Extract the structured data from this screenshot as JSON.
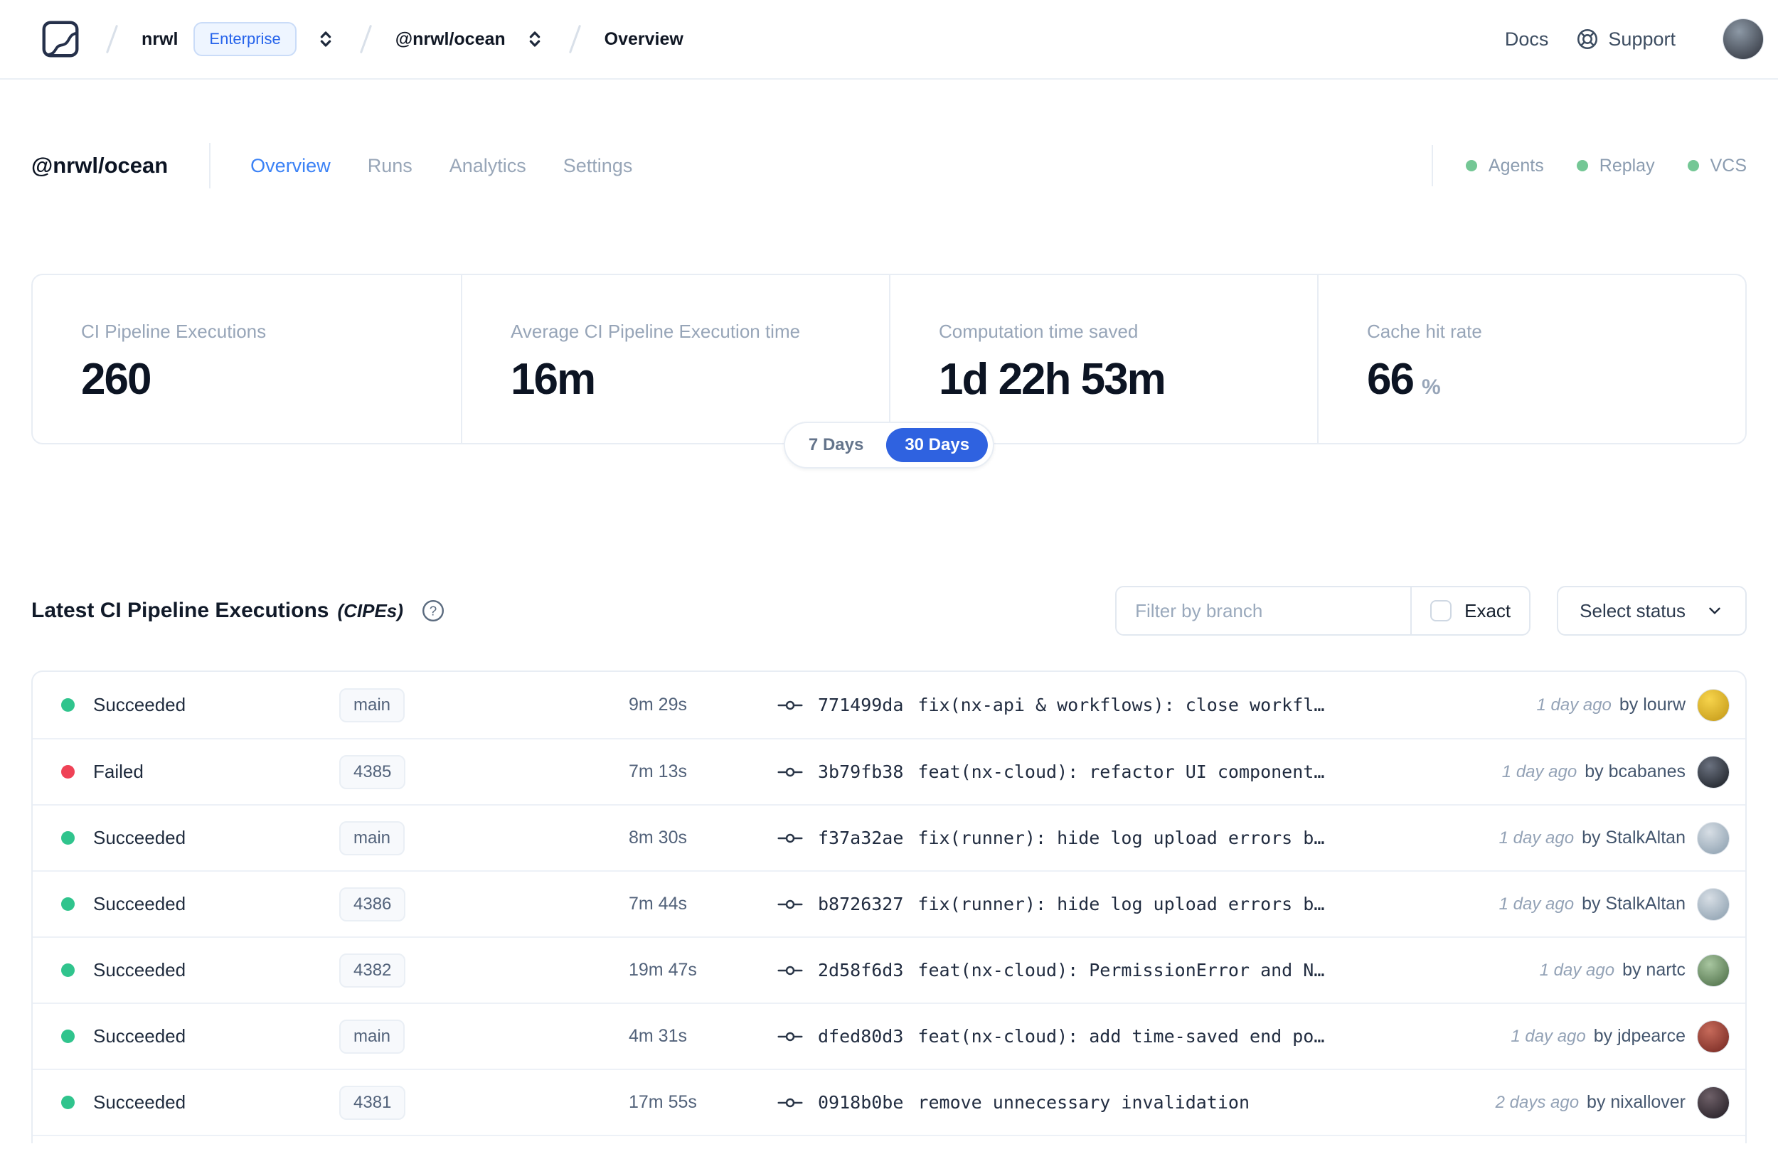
{
  "colors": {
    "accent_blue": "#2f62e0",
    "tab_active_blue": "#3b82f6",
    "enterprise_blue": "#2563eb",
    "success_green": "#30c48d",
    "failed_red": "#ef4256",
    "indicator_green": "#74c795"
  },
  "navbar": {
    "breadcrumb": {
      "org": "nrwl",
      "org_badge": "Enterprise",
      "workspace": "@nrwl/ocean",
      "page": "Overview"
    },
    "docs_label": "Docs",
    "support_label": "Support",
    "avatar": {
      "light": "#8d99a6",
      "dark": "#3a3f49"
    }
  },
  "workspace_header": {
    "title": "@nrwl/ocean",
    "tabs": [
      {
        "label": "Overview",
        "active": true
      },
      {
        "label": "Runs",
        "active": false
      },
      {
        "label": "Analytics",
        "active": false
      },
      {
        "label": "Settings",
        "active": false
      }
    ],
    "status_indicators": [
      {
        "label": "Agents"
      },
      {
        "label": "Replay"
      },
      {
        "label": "VCS"
      }
    ]
  },
  "stats": {
    "cards": [
      {
        "label": "CI Pipeline Executions",
        "value": "260",
        "suffix": ""
      },
      {
        "label": "Average CI Pipeline Execution time",
        "value": "16m",
        "suffix": ""
      },
      {
        "label": "Computation time saved",
        "value": "1d 22h 53m",
        "suffix": ""
      },
      {
        "label": "Cache hit rate",
        "value": "66",
        "suffix": "%"
      }
    ]
  },
  "range_toggle": {
    "options": [
      {
        "label": "7 Days",
        "active": false
      },
      {
        "label": "30 Days",
        "active": true
      }
    ]
  },
  "cipe_section": {
    "title": "Latest CI Pipeline Executions",
    "title_suffix": "(CIPEs)",
    "filter_placeholder": "Filter by branch",
    "exact_label": "Exact",
    "select_status_label": "Select status"
  },
  "table": {
    "rows": [
      {
        "status": "Succeeded",
        "status_color": "#30c48d",
        "branch": "main",
        "duration": "9m 29s",
        "commit_hash": "771499da",
        "commit_message": "fix(nx-api & workflows): close workfl…",
        "time_ago": "1 day ago",
        "author": "by lourw",
        "avatar": {
          "light": "#f7d44c",
          "dark": "#c99f1d"
        }
      },
      {
        "status": "Failed",
        "status_color": "#ef4256",
        "branch": "4385",
        "duration": "7m 13s",
        "commit_hash": "3b79fb38",
        "commit_message": "feat(nx-cloud): refactor UI component…",
        "time_ago": "1 day ago",
        "author": "by bcabanes",
        "avatar": {
          "light": "#6b7280",
          "dark": "#23272e"
        }
      },
      {
        "status": "Succeeded",
        "status_color": "#30c48d",
        "branch": "main",
        "duration": "8m 30s",
        "commit_hash": "f37a32ae",
        "commit_message": "fix(runner): hide log upload errors b…",
        "time_ago": "1 day ago",
        "author": "by StalkAltan",
        "avatar": {
          "light": "#d7dee5",
          "dark": "#93a5b4"
        }
      },
      {
        "status": "Succeeded",
        "status_color": "#30c48d",
        "branch": "4386",
        "duration": "7m 44s",
        "commit_hash": "b8726327",
        "commit_message": "fix(runner): hide log upload errors b…",
        "time_ago": "1 day ago",
        "author": "by StalkAltan",
        "avatar": {
          "light": "#d7dee5",
          "dark": "#93a5b4"
        }
      },
      {
        "status": "Succeeded",
        "status_color": "#30c48d",
        "branch": "4382",
        "duration": "19m 47s",
        "commit_hash": "2d58f6d3",
        "commit_message": "feat(nx-cloud): PermissionError and N…",
        "time_ago": "1 day ago",
        "author": "by nartc",
        "avatar": {
          "light": "#a8c6a0",
          "dark": "#55764f"
        }
      },
      {
        "status": "Succeeded",
        "status_color": "#30c48d",
        "branch": "main",
        "duration": "4m 31s",
        "commit_hash": "dfed80d3",
        "commit_message": "feat(nx-cloud): add time-saved end po…",
        "time_ago": "1 day ago",
        "author": "by jdpearce",
        "avatar": {
          "light": "#c66a5a",
          "dark": "#7e2f28"
        }
      },
      {
        "status": "Succeeded",
        "status_color": "#30c48d",
        "branch": "4381",
        "duration": "17m 55s",
        "commit_hash": "0918b0be",
        "commit_message": "remove unnecessary invalidation",
        "time_ago": "2 days ago",
        "author": "by nixallover",
        "avatar": {
          "light": "#6e6068",
          "dark": "#2b242b"
        }
      }
    ]
  }
}
